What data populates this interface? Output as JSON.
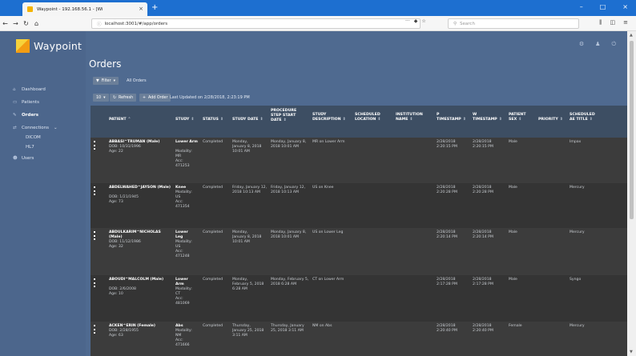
{
  "browser": {
    "tab_title": "Waypoint - 192.168.56.1 - [Wi",
    "url": "localhost:3001/#/app/orders",
    "url_dots": "···",
    "search_placeholder": "Search"
  },
  "app": {
    "brand": "Waypoint",
    "title": "Orders",
    "accent": "#f7d23a"
  },
  "sidebar": {
    "items": [
      {
        "label": "Dashboard",
        "icon": "home-icon"
      },
      {
        "label": "Patients",
        "icon": "id-card-icon"
      },
      {
        "label": "Orders",
        "icon": "edit-icon"
      },
      {
        "label": "Connections",
        "icon": "connections-icon"
      },
      {
        "label": "Users",
        "icon": "users-icon"
      }
    ],
    "connections_sub": [
      "DICOM",
      "HL7"
    ]
  },
  "toolbar": {
    "filter": "Filter",
    "filter_value": "All Orders",
    "page_size": "10",
    "refresh": "Refresh",
    "add_order": "Add Order",
    "last_updated": "Last Updated on 2/28/2018, 2:23:19 PM"
  },
  "columns": [
    "PATIENT",
    "STUDY",
    "STATUS",
    "STUDY DATE",
    "PROCEDURE STEP START DATE",
    "STUDY DESCRIPTION",
    "SCHEDULED LOCATION",
    "INSTITUTION NAME",
    "P TIMESTAMP",
    "W TIMESTAMP",
    "PATIENT SEX",
    "PRIORITY",
    "SCHEDULED AE TITLE"
  ],
  "rows": [
    {
      "name": "ABBASI^TRUMAN (Male)",
      "dob": "DOB: 10/31/1996",
      "age": "Age: 22",
      "study": "Lower Arm",
      "study_lines": [
        "Modality:",
        "MR",
        "Acc:",
        "471253"
      ],
      "status": "Completed",
      "study_date": "Monday, January 8, 2018 10:01 AM",
      "proc_date": "Monday, January 8, 2018 10:01 AM",
      "desc": "MR on Lower Arm",
      "p_ts": "2/28/2018 2:20:15 PM",
      "w_ts": "2/28/2018 2:20:15 PM",
      "sex": "Male",
      "ae": "Impax"
    },
    {
      "name": "ABDELWAHED^JAYSON (Male)",
      "dob": "DOB: 1/21/1945",
      "age": "Age: 73",
      "study": "Knee",
      "study_lines": [
        "Modality:",
        "US",
        "Acc:",
        "471354"
      ],
      "status": "Completed",
      "study_date": "Friday, January 12, 2018 10:13 AM",
      "proc_date": "Friday, January 12, 2018 10:13 AM",
      "desc": "US on Knee",
      "p_ts": "2/28/2018 2:20:28 PM",
      "w_ts": "2/28/2018 2:20:28 PM",
      "sex": "Male",
      "ae": "Mercury"
    },
    {
      "name": "ABDULKARIM^NICHOLAS (Male)",
      "dob": "DOB: 11/12/1986",
      "age": "Age: 32",
      "study": "Lower Leg",
      "study_lines": [
        "Modality:",
        "US",
        "Acc:",
        "471248"
      ],
      "status": "Completed",
      "study_date": "Monday, January 8, 2018 10:01 AM",
      "proc_date": "Monday, January 8, 2018 10:01 AM",
      "desc": "US on Lower Leg",
      "p_ts": "2/28/2018 2:20:14 PM",
      "w_ts": "2/28/2018 2:20:14 PM",
      "sex": "Male",
      "ae": "Mercury"
    },
    {
      "name": "ABOUDI^MALCOLM (Male)",
      "dob": "DOB: 2/6/2008",
      "age": "Age: 10",
      "study": "Lower Arm",
      "study_lines": [
        "Modality:",
        "CT",
        "Acc:",
        "481069"
      ],
      "status": "Completed",
      "study_date": "Monday, February 5, 2018 6:28 AM",
      "proc_date": "Monday, February 5, 2018 6:28 AM",
      "desc": "CT on Lower Arm",
      "p_ts": "2/28/2018 2:17:28 PM",
      "w_ts": "2/28/2018 2:17:28 PM",
      "sex": "Male",
      "ae": "Syngo"
    },
    {
      "name": "ACKEN^ERIN (Female)",
      "dob": "DOB: 2/28/1955",
      "age": "Age: 63",
      "study": "Abs",
      "study_lines": [
        "Modality:",
        "NM",
        "Acc:",
        "471666"
      ],
      "status": "Completed",
      "study_date": "Thursday, January 25, 2018 3:11 AM",
      "proc_date": "Thursday, January 25, 2018 3:11 AM",
      "desc": "NM on Abs",
      "p_ts": "2/28/2018 2:20:40 PM",
      "w_ts": "2/28/2018 2:20:40 PM",
      "sex": "Female",
      "ae": "Mercury"
    }
  ]
}
